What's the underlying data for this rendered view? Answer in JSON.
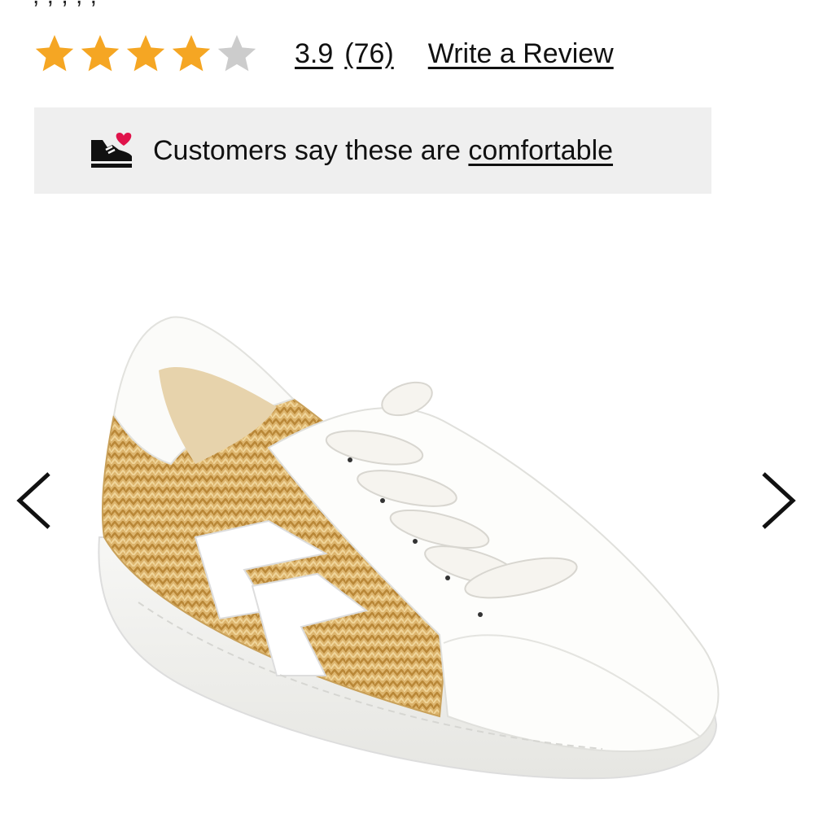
{
  "product": {
    "cut_title": ", , , , ,"
  },
  "rating": {
    "value": "3.9",
    "count": "(76)",
    "write_review": "Write a Review",
    "stars_filled": 4,
    "stars_total": 5,
    "star_color": "#f5a623",
    "star_empty_color": "#cccccc"
  },
  "comfort": {
    "prefix": "Customers say these are ",
    "link": "comfortable",
    "icon": "shoe-heart-icon",
    "heart_color": "#e0134b"
  },
  "gallery": {
    "image": "white-leather-woven-raffia-sneaker",
    "prev_icon": "chevron-left-icon",
    "next_icon": "chevron-right-icon"
  }
}
